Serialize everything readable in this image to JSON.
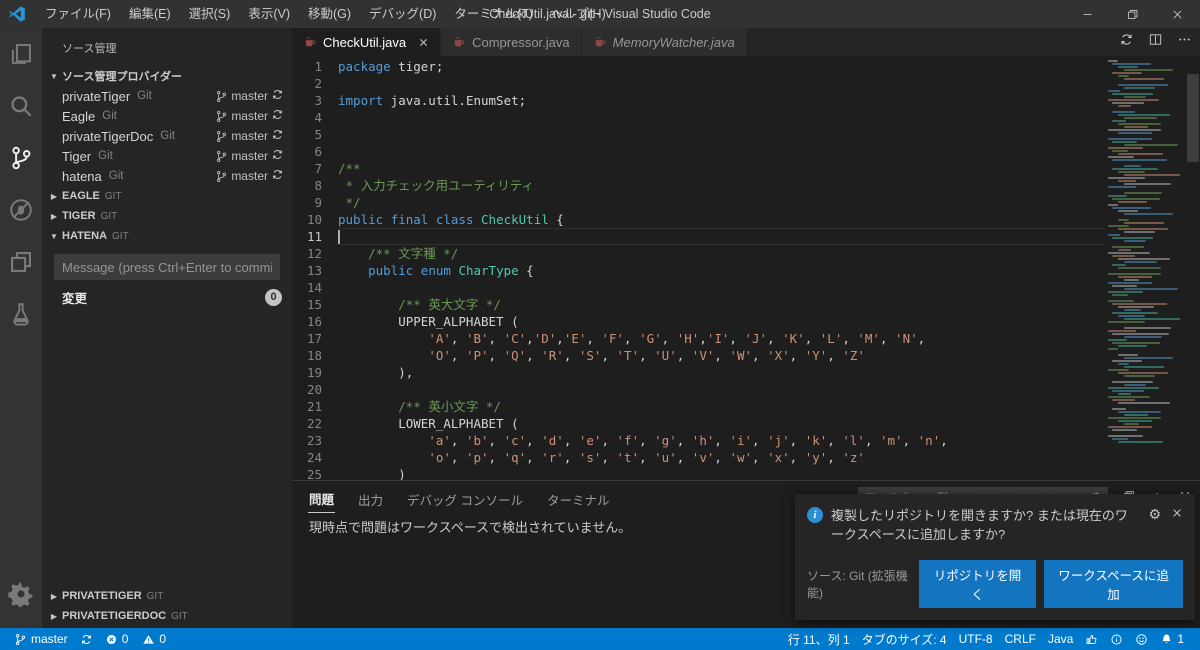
{
  "window": {
    "title": "CheckUtil.java - git - Visual Studio Code",
    "menus": [
      "ファイル(F)",
      "編集(E)",
      "選択(S)",
      "表示(V)",
      "移動(G)",
      "デバッグ(D)",
      "ターミナル(T)",
      "ヘルプ(H)"
    ]
  },
  "sidebar": {
    "title": "ソース管理",
    "providers_header": "ソース管理プロバイダー",
    "providers": [
      {
        "name": "privateTiger",
        "type": "Git",
        "branch": "master"
      },
      {
        "name": "Eagle",
        "type": "Git",
        "branch": "master"
      },
      {
        "name": "privateTigerDoc",
        "type": "Git",
        "branch": "master"
      },
      {
        "name": "Tiger",
        "type": "Git",
        "branch": "master"
      },
      {
        "name": "hatena",
        "type": "Git",
        "branch": "master"
      }
    ],
    "repo_sections": [
      {
        "label": "EAGLE",
        "type": "GIT",
        "expanded": false
      },
      {
        "label": "TIGER",
        "type": "GIT",
        "expanded": false
      },
      {
        "label": "HATENA",
        "type": "GIT",
        "expanded": true
      }
    ],
    "commit_placeholder": "Message (press Ctrl+Enter to commit)",
    "changes_label": "変更",
    "changes_count": "0",
    "bottom_sections": [
      {
        "label": "PRIVATETIGER",
        "type": "GIT"
      },
      {
        "label": "PRIVATETIGERDOC",
        "type": "GIT"
      }
    ]
  },
  "tabs": [
    {
      "label": "CheckUtil.java",
      "state": "active"
    },
    {
      "label": "Compressor.java",
      "state": "inactive"
    },
    {
      "label": "MemoryWatcher.java",
      "state": "preview"
    }
  ],
  "code": {
    "current_line": 11,
    "lines": [
      {
        "n": 1,
        "t": [
          [
            "k",
            "package"
          ],
          [
            "p",
            " tiger;"
          ]
        ]
      },
      {
        "n": 2,
        "t": []
      },
      {
        "n": 3,
        "t": [
          [
            "k",
            "import"
          ],
          [
            "p",
            " java.util.EnumSet;"
          ]
        ]
      },
      {
        "n": 4,
        "t": []
      },
      {
        "n": 5,
        "t": []
      },
      {
        "n": 6,
        "t": []
      },
      {
        "n": 7,
        "t": [
          [
            "m",
            "/**"
          ]
        ]
      },
      {
        "n": 8,
        "t": [
          [
            "m",
            " * 入力チェック用ユーティリティ"
          ]
        ]
      },
      {
        "n": 9,
        "t": [
          [
            "m",
            " */"
          ]
        ]
      },
      {
        "n": 10,
        "t": [
          [
            "k",
            "public"
          ],
          [
            "p",
            " "
          ],
          [
            "k",
            "final"
          ],
          [
            "p",
            " "
          ],
          [
            "k",
            "class"
          ],
          [
            "p",
            " "
          ],
          [
            "c",
            "CheckUtil"
          ],
          [
            "p",
            " {"
          ]
        ]
      },
      {
        "n": 11,
        "t": []
      },
      {
        "n": 12,
        "t": [
          [
            "p",
            "    "
          ],
          [
            "m",
            "/** 文字種 */"
          ]
        ]
      },
      {
        "n": 13,
        "t": [
          [
            "p",
            "    "
          ],
          [
            "k",
            "public"
          ],
          [
            "p",
            " "
          ],
          [
            "k",
            "enum"
          ],
          [
            "p",
            " "
          ],
          [
            "c",
            "CharType"
          ],
          [
            "p",
            " {"
          ]
        ]
      },
      {
        "n": 14,
        "t": []
      },
      {
        "n": 15,
        "t": [
          [
            "p",
            "        "
          ],
          [
            "m",
            "/** 英大文字 */"
          ]
        ]
      },
      {
        "n": 16,
        "t": [
          [
            "p",
            "        UPPER_ALPHABET ("
          ]
        ]
      },
      {
        "n": 17,
        "t": [
          [
            "p",
            "            "
          ],
          [
            "l",
            "'A', 'B', 'C','D','E', 'F', 'G', 'H','I', 'J', 'K', 'L', 'M', 'N',"
          ]
        ]
      },
      {
        "n": 18,
        "t": [
          [
            "p",
            "            "
          ],
          [
            "l",
            "'O', 'P', 'Q', 'R', 'S', 'T', 'U', 'V', 'W', 'X', 'Y', 'Z'"
          ]
        ]
      },
      {
        "n": 19,
        "t": [
          [
            "p",
            "        ),"
          ]
        ]
      },
      {
        "n": 20,
        "t": []
      },
      {
        "n": 21,
        "t": [
          [
            "p",
            "        "
          ],
          [
            "m",
            "/** 英小文字 */"
          ]
        ]
      },
      {
        "n": 22,
        "t": [
          [
            "p",
            "        LOWER_ALPHABET ("
          ]
        ]
      },
      {
        "n": 23,
        "t": [
          [
            "p",
            "            "
          ],
          [
            "l",
            "'a', 'b', 'c', 'd', 'e', 'f', 'g', 'h', 'i', 'j', 'k', 'l', 'm', 'n',"
          ]
        ]
      },
      {
        "n": 24,
        "t": [
          [
            "p",
            "            "
          ],
          [
            "l",
            "'o', 'p', 'q', 'r', 's', 't', 'u', 'v', 'w', 'x', 'y', 'z'"
          ]
        ]
      },
      {
        "n": 25,
        "t": [
          [
            "p",
            "        )"
          ]
        ]
      }
    ]
  },
  "panel": {
    "tabs": [
      {
        "label": "問題",
        "active": true
      },
      {
        "label": "出力",
        "active": false
      },
      {
        "label": "デバッグ コンソール",
        "active": false
      },
      {
        "label": "ターミナル",
        "active": false
      }
    ],
    "filter_placeholder": "フィルター。例: text, **/*.ts, !**/node_modules/**",
    "message": "現時点で問題はワークスペースで検出されていません。"
  },
  "notification": {
    "message": "複製したリポジトリを開きますか? または現在のワークスペースに追加しますか?",
    "source": "ソース: Git (拡張機能)",
    "open_repo_label": "リポジトリを開く",
    "add_workspace_label": "ワークスペースに追加"
  },
  "status_bar": {
    "branch": "master",
    "errors": "0",
    "warnings": "0",
    "line_col": "行 11、列 1",
    "tab_size": "タブのサイズ: 4",
    "encoding": "UTF-8",
    "eol": "CRLF",
    "language": "Java",
    "notifications_count": "1"
  },
  "colors": {
    "statusbar": "#007acc",
    "keyword": "#569cd6",
    "class_name": "#4ec9b0",
    "comment": "#6a9955",
    "string": "#ce9178",
    "notification_button": "#1374c0"
  }
}
